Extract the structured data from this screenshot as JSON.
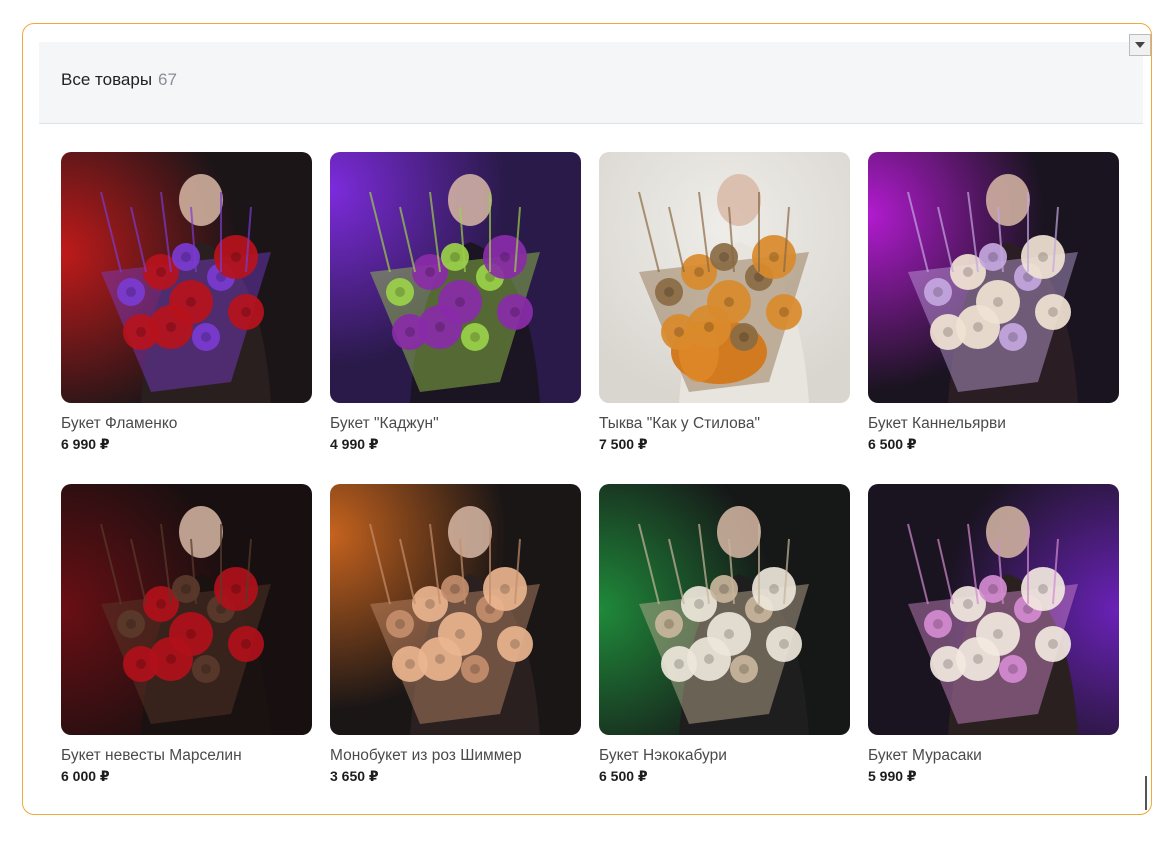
{
  "header": {
    "title": "Все товары",
    "count": "67"
  },
  "products": [
    {
      "name": "Букет Фламенко",
      "price": "6 990 ₽",
      "palette": {
        "bg": "#1c1518",
        "glow": "#c01a1a",
        "accent": "#b7121c",
        "second": "#7a3bd1",
        "person": "#2a1f1f"
      }
    },
    {
      "name": "Букет \"Каджун\"",
      "price": "4 990 ₽",
      "palette": {
        "bg": "#2a1a4a",
        "glow": "#7d2bdc",
        "accent": "#8a2ba8",
        "second": "#9bd14a",
        "person": "#1b1422"
      }
    },
    {
      "name": "Тыква \"Как у Стилова\"",
      "price": "7 500 ₽",
      "palette": {
        "bg": "#d9d6d0",
        "glow": "#efede9",
        "accent": "#d98a2b",
        "second": "#8a6a44",
        "person": "#e8e4de"
      }
    },
    {
      "name": "Букет Каннельярви",
      "price": "6 500 ₽",
      "palette": {
        "bg": "#1a1420",
        "glow": "#b21bd0",
        "accent": "#f1e3d4",
        "second": "#c4a7e0",
        "person": "#2a1e24"
      }
    },
    {
      "name": "Букет невесты Марселин",
      "price": "6 000 ₽",
      "palette": {
        "bg": "#170f10",
        "glow": "#6a0f14",
        "accent": "#b0101a",
        "second": "#5a3a2a",
        "person": "#1a1111"
      }
    },
    {
      "name": "Монобукет из роз Шиммер",
      "price": "3 650 ₽",
      "palette": {
        "bg": "#1b1616",
        "glow": "#c6631e",
        "accent": "#e9b48e",
        "second": "#c48e6c",
        "person": "#2a2020"
      }
    },
    {
      "name": "Букет Нэкокабури",
      "price": "6 500 ₽",
      "palette": {
        "bg": "#161818",
        "glow": "#1f8a3a",
        "accent": "#ede6da",
        "second": "#c9b69c",
        "person": "#1e1e1e"
      }
    },
    {
      "name": "Букет Мурасаки",
      "price": "5 990 ₽",
      "palette": {
        "bg": "#1a1420",
        "glow": "#6a22b8",
        "accent": "#f2e8e0",
        "second": "#d48bd0",
        "person": "#2a2020"
      }
    }
  ]
}
